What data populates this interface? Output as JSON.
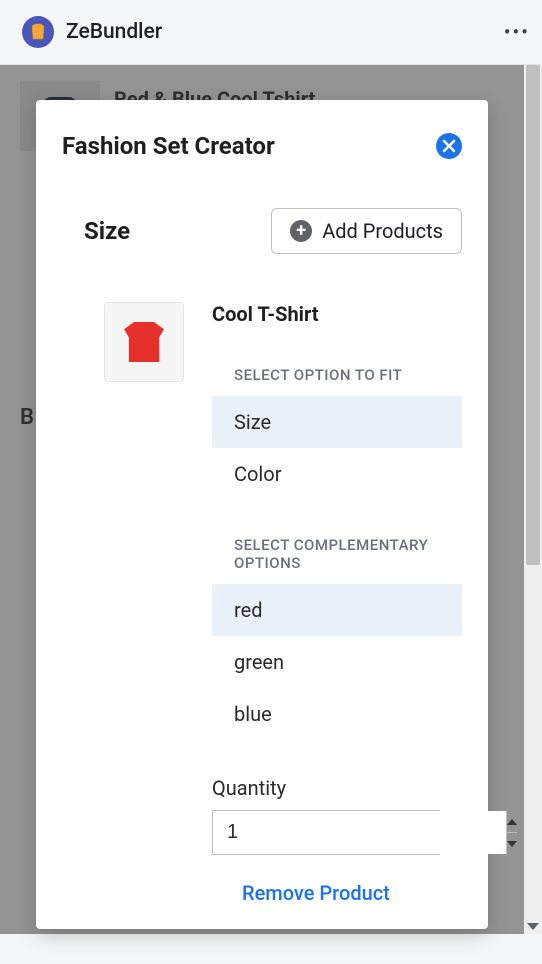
{
  "app": {
    "title": "ZeBundler",
    "menu_label": "more"
  },
  "background": {
    "item_title": "Red & Blue Cool Tshirt",
    "row2_prefix": "B"
  },
  "modal": {
    "title": "Fashion Set Creator",
    "size_label": "Size",
    "add_products_label": "Add Products",
    "product": {
      "name": "Cool T-Shirt",
      "thumb_alt": "red t-shirt",
      "fit_section_label": "SELECT OPTION TO FIT",
      "fit_options": [
        "Size",
        "Color"
      ],
      "fit_selected": "Size",
      "comp_section_label": "SELECT COMPLEMENTARY OPTIONS",
      "comp_options": [
        "red",
        "green",
        "blue"
      ],
      "comp_selected": "red",
      "quantity_label": "Quantity",
      "quantity_value": "1",
      "remove_label": "Remove Product"
    }
  }
}
